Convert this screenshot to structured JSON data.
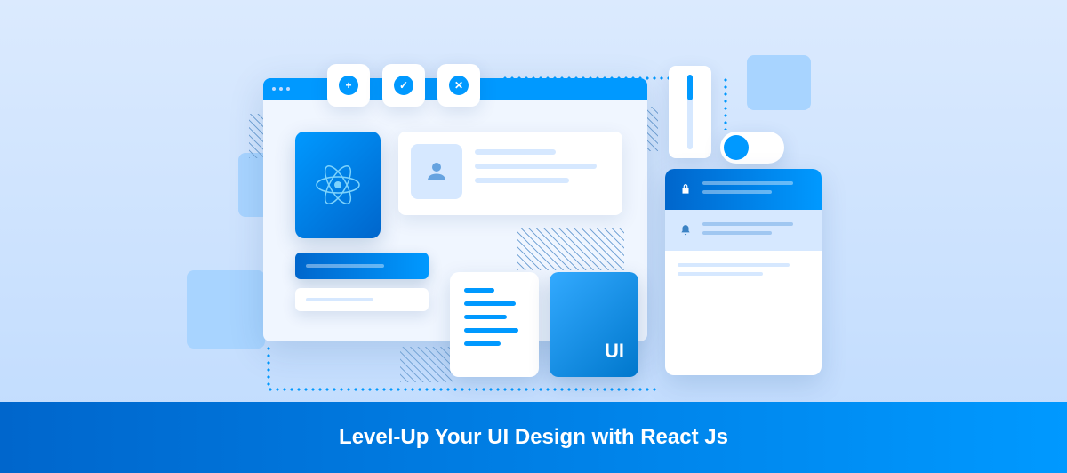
{
  "footer": {
    "title": "Level-Up Your UI Design with React Js"
  },
  "ui_card": {
    "label": "UI"
  },
  "action_buttons": [
    {
      "name": "plus-icon",
      "glyph": "+"
    },
    {
      "name": "check-icon",
      "glyph": "✓"
    },
    {
      "name": "close-icon",
      "glyph": "✕"
    }
  ],
  "notifications": [
    {
      "variant": "blue",
      "icon": "lock-icon"
    },
    {
      "variant": "light",
      "icon": "bell-icon"
    },
    {
      "variant": "white",
      "icon": "none"
    }
  ]
}
